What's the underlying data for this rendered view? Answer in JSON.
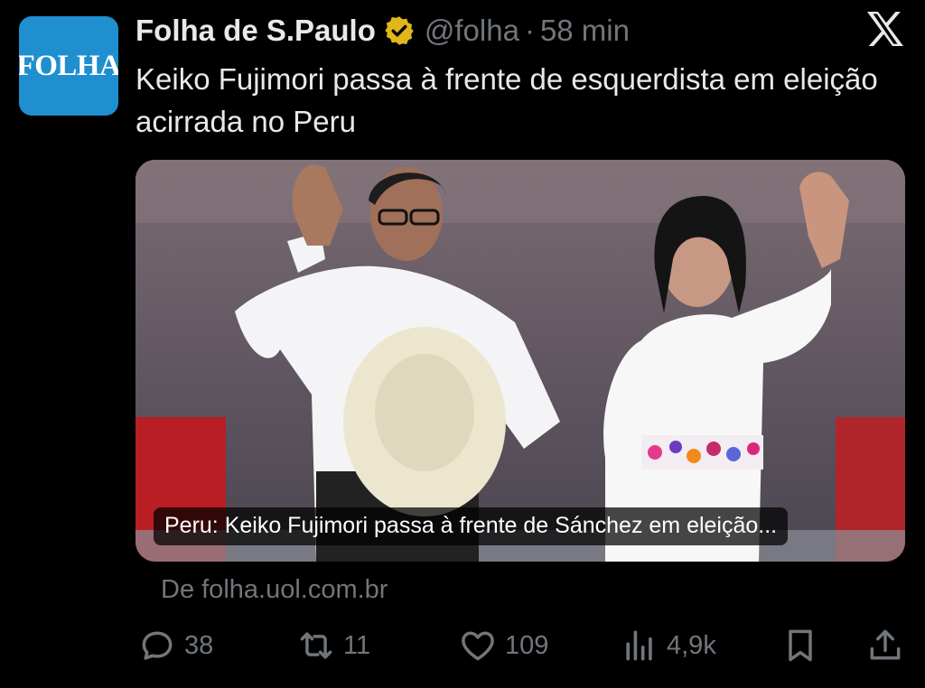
{
  "account": {
    "avatar_text": "FOLHA",
    "name": "Folha de S.Paulo",
    "handle": "@folha",
    "separator": "·",
    "time": "58 min"
  },
  "tweet": {
    "text": "Keiko Fujimori passa à frente de esquerdista em eleição acirrada no Peru"
  },
  "card": {
    "caption": "Peru: Keiko Fujimori passa à frente de Sánchez em eleição...",
    "source": "De folha.uol.com.br"
  },
  "actions": {
    "replies": "38",
    "reposts": "11",
    "likes": "109",
    "views": "4,9k"
  },
  "icons": {
    "verified": "verified-badge-icon",
    "platform": "x-logo-icon",
    "reply": "reply-icon",
    "repost": "repost-icon",
    "like": "heart-icon",
    "views": "views-icon",
    "bookmark": "bookmark-icon",
    "share": "share-icon"
  },
  "colors": {
    "background": "#000000",
    "text": "#e7e9ea",
    "muted": "#71767b",
    "brand": "#1f8fd0",
    "verified": "#e2b719"
  }
}
